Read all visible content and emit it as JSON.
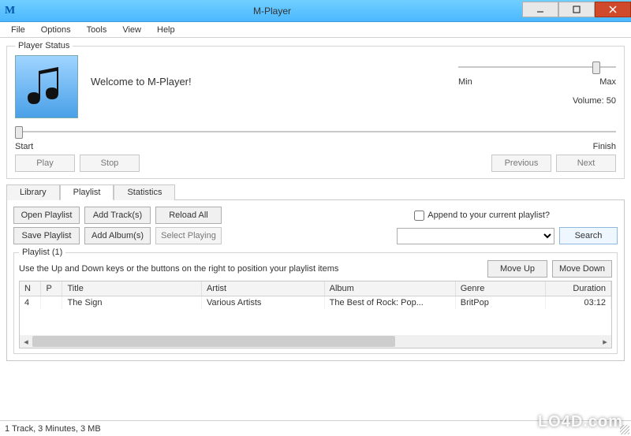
{
  "window": {
    "title": "M-Player",
    "app_icon_letter": "M"
  },
  "menu": {
    "file": "File",
    "options": "Options",
    "tools": "Tools",
    "view": "View",
    "help": "Help"
  },
  "player_status": {
    "legend": "Player Status",
    "welcome": "Welcome to M-Player!",
    "volume": {
      "min_label": "Min",
      "max_label": "Max",
      "value_text": "Volume: 50",
      "percent": 85
    },
    "progress": {
      "start_label": "Start",
      "finish_label": "Finish"
    },
    "buttons": {
      "play": "Play",
      "stop": "Stop",
      "previous": "Previous",
      "next": "Next"
    }
  },
  "tabs": {
    "library": "Library",
    "playlist": "Playlist",
    "statistics": "Statistics"
  },
  "playlist_tab": {
    "open_playlist": "Open Playlist",
    "add_tracks": "Add Track(s)",
    "reload_all": "Reload All",
    "save_playlist": "Save Playlist",
    "add_albums": "Add Album(s)",
    "select_playing": "Select Playing",
    "append_label": "Append to your current playlist?",
    "search": "Search"
  },
  "playlist_group": {
    "legend": "Playlist (1)",
    "hint": "Use the Up and Down keys or the buttons on the right to position your playlist items",
    "move_up": "Move Up",
    "move_down": "Move Down",
    "columns": {
      "n": "N",
      "p": "P",
      "title": "Title",
      "artist": "Artist",
      "album": "Album",
      "genre": "Genre",
      "duration": "Duration"
    },
    "rows": [
      {
        "n": "4",
        "p": "",
        "title": "The Sign",
        "artist": "Various Artists",
        "album": "The Best of Rock: Pop...",
        "genre": "BritPop",
        "duration": "03:12"
      }
    ]
  },
  "statusbar": {
    "text": "1 Track, 3 Minutes, 3 MB"
  },
  "watermark": "LO4D.com"
}
